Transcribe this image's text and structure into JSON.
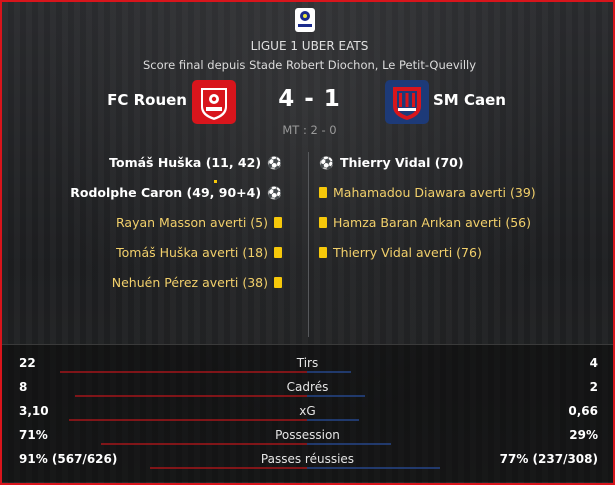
{
  "header": {
    "competition": "LIGUE 1 UBER EATS",
    "venue_line": "Score final depuis Stade Robert Diochon, Le Petit-Quevilly"
  },
  "match": {
    "home_team": "FC Rouen",
    "away_team": "SM Caen",
    "score": "4 - 1",
    "half_time": "MT : 2 - 0",
    "home_crest_color": "#d8151c",
    "away_crest_color": "#1d3a78"
  },
  "home_events": [
    {
      "text": "Tomáš Huška (11, 42)",
      "type": "goal"
    },
    {
      "text": "Rodolphe Caron (49, 90+4)",
      "type": "goal"
    },
    {
      "text": "Rayan Masson averti (5)",
      "type": "yellow"
    },
    {
      "text": "Tomáš Huška averti (18)",
      "type": "yellow"
    },
    {
      "text": "Nehuén Pérez averti (38)",
      "type": "yellow"
    }
  ],
  "away_events": [
    {
      "text": "Thierry Vidal (70)",
      "type": "goal"
    },
    {
      "text": "Mahamadou Diawara averti (39)",
      "type": "yellow"
    },
    {
      "text": "Hamza Baran Arıkan averti (56)",
      "type": "yellow"
    },
    {
      "text": "Thierry Vidal averti (76)",
      "type": "yellow"
    }
  ],
  "stats": [
    {
      "label": "Tirs",
      "home": "22",
      "away": "4",
      "home_share": 0.85,
      "away_share": 0.15
    },
    {
      "label": "Cadrés",
      "home": "8",
      "away": "2",
      "home_share": 0.8,
      "away_share": 0.2
    },
    {
      "label": "xG",
      "home": "3,10",
      "away": "0,66",
      "home_share": 0.82,
      "away_share": 0.18
    },
    {
      "label": "Possession",
      "home": "71%",
      "away": "29%",
      "home_share": 0.71,
      "away_share": 0.29
    },
    {
      "label": "Passes réussies",
      "home": "91% (567/626)",
      "away": "77% (237/308)",
      "home_share": 0.54,
      "away_share": 0.46
    }
  ],
  "colors": {
    "accent_border": "#d8151c",
    "yellow_card": "#f6c80a",
    "home_bar": "#d8151c",
    "away_bar": "#2c57b5"
  },
  "icons": {
    "league": "ligue1-logo-icon",
    "goal": "football-icon",
    "yellow": "yellow-card-icon"
  }
}
